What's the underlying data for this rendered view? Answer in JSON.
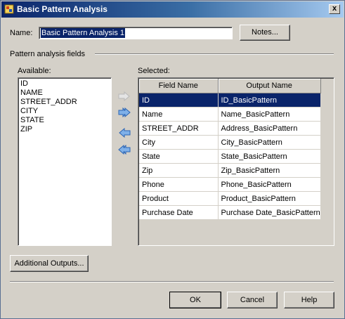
{
  "window": {
    "title": "Basic Pattern Analysis",
    "close_glyph": "x"
  },
  "name": {
    "label": "Name:",
    "value": "Basic Pattern Analysis 1",
    "notes_button": "Notes..."
  },
  "fields_group": {
    "title": "Pattern analysis fields"
  },
  "available": {
    "label": "Available:",
    "items": [
      "ID",
      "NAME",
      "STREET_ADDR",
      "CITY",
      "STATE",
      "ZIP"
    ]
  },
  "selected": {
    "label": "Selected:",
    "columns": [
      "Field Name",
      "Output Name"
    ],
    "rows": [
      {
        "field": "ID",
        "output": "ID_BasicPattern"
      },
      {
        "field": "Name",
        "output": "Name_BasicPattern"
      },
      {
        "field": "STREET_ADDR",
        "output": "Address_BasicPattern"
      },
      {
        "field": "City",
        "output": "City_BasicPattern"
      },
      {
        "field": "State",
        "output": "State_BasicPattern"
      },
      {
        "field": "Zip",
        "output": "Zip_BasicPattern"
      },
      {
        "field": "Phone",
        "output": "Phone_BasicPattern"
      },
      {
        "field": "Product",
        "output": "Product_BasicPattern"
      },
      {
        "field": "Purchase Date",
        "output": "Purchase Date_BasicPattern"
      }
    ],
    "selected_row": 0
  },
  "move_buttons": [
    "move-right-icon",
    "move-all-right-icon",
    "move-left-icon",
    "move-all-left-icon"
  ],
  "buttons": {
    "additional_outputs": "Additional Outputs...",
    "ok": "OK",
    "cancel": "Cancel",
    "help": "Help"
  },
  "colors": {
    "titlebar": "#0a246a",
    "selection": "#0a246a",
    "dialog_bg": "#d4d0c8",
    "arrow_enabled": "#3a78c8",
    "arrow_disabled": "#b8b8b8"
  }
}
